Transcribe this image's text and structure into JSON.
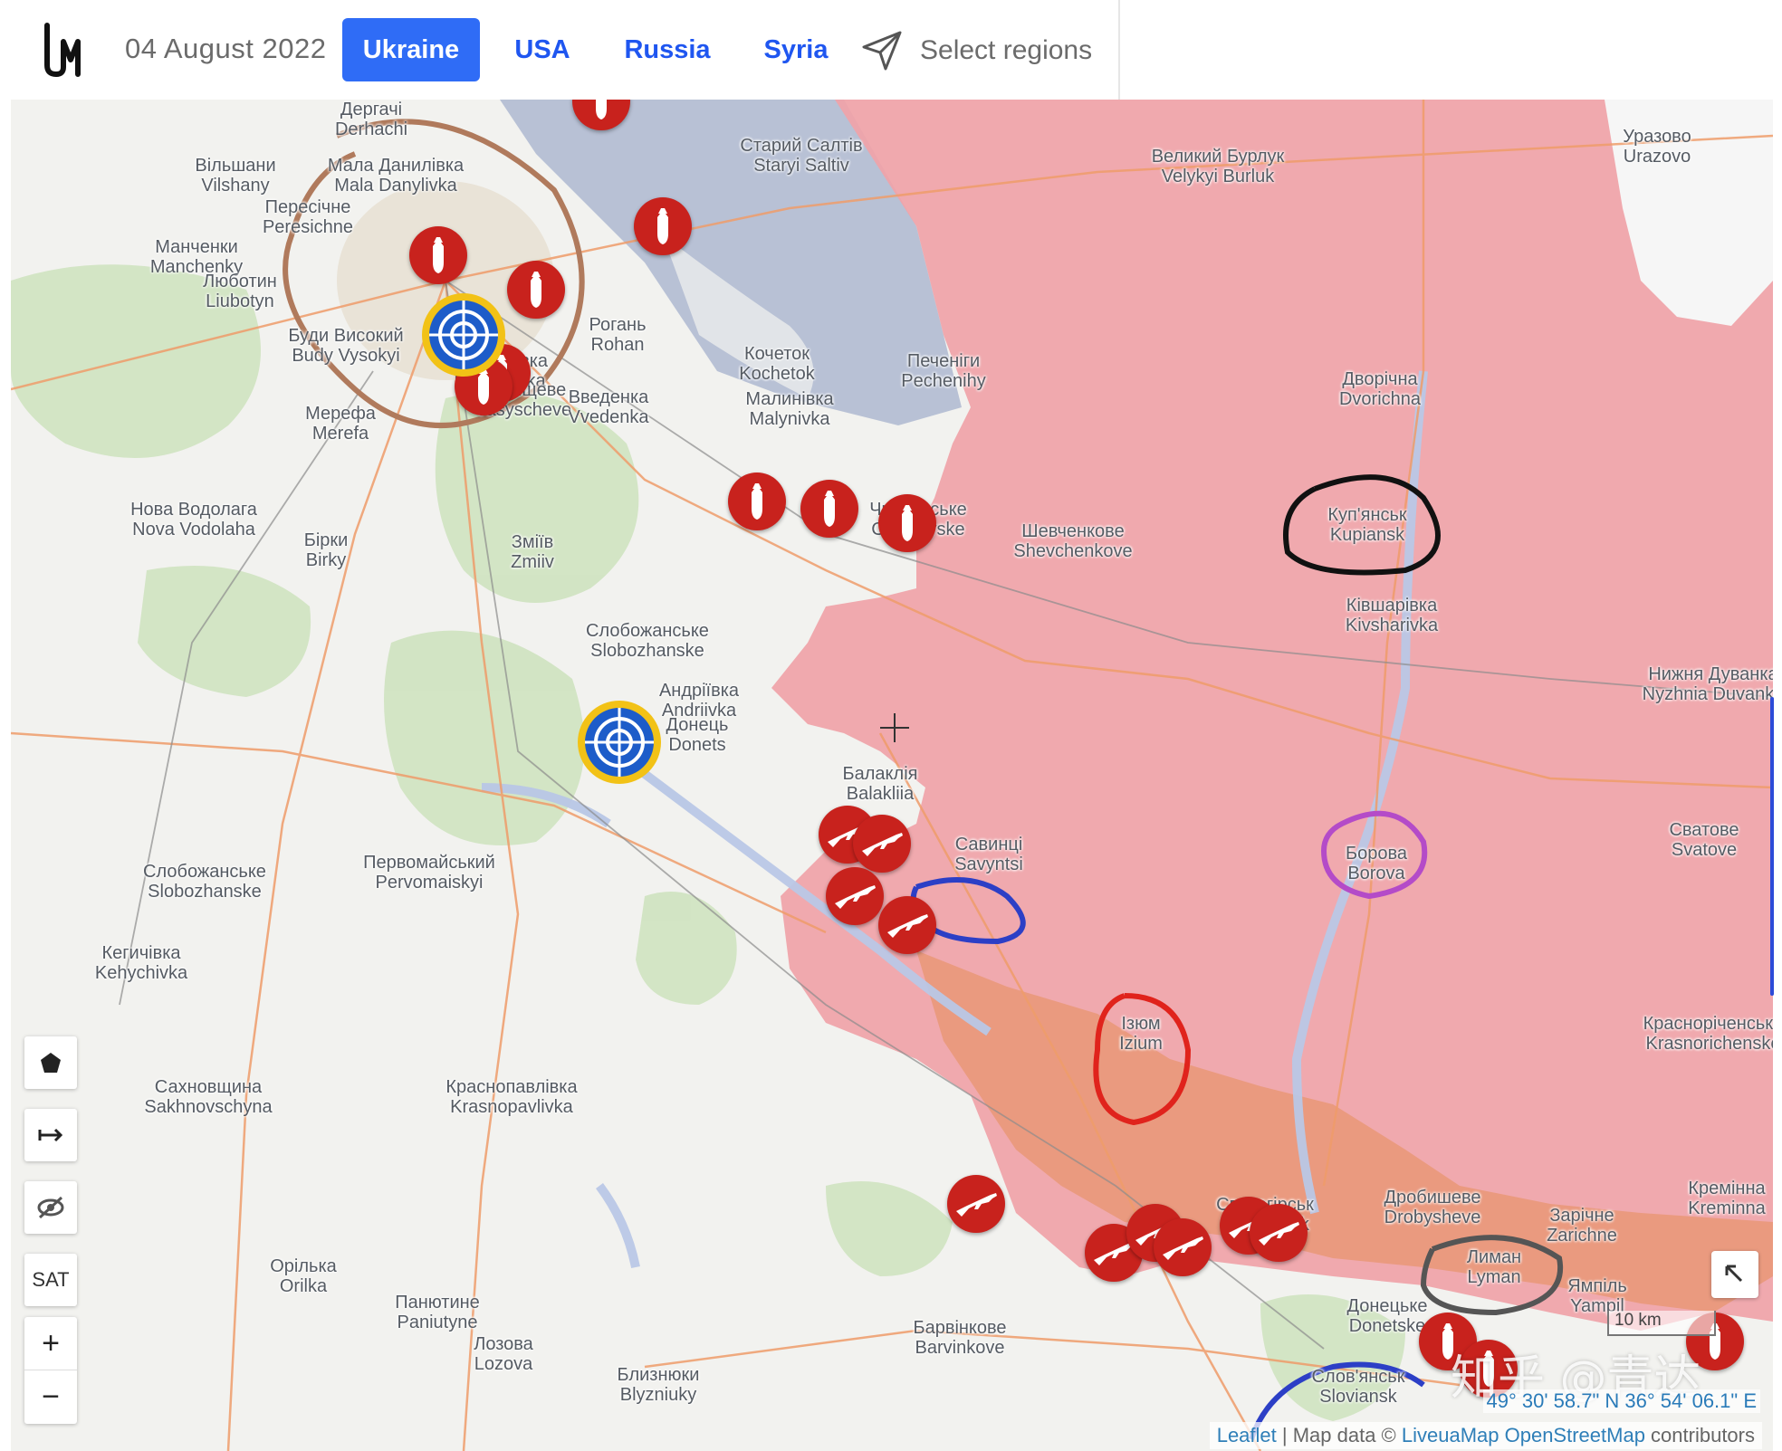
{
  "header": {
    "logo_icon": "liveuamap-logo-icon",
    "date": "04 August 2022",
    "tabs": [
      {
        "label": "Ukraine",
        "active": true
      },
      {
        "label": "USA",
        "active": false
      },
      {
        "label": "Russia",
        "active": false
      },
      {
        "label": "Syria",
        "active": false
      }
    ],
    "select_regions": {
      "icon": "navigation-arrow-icon",
      "label": "Select regions"
    }
  },
  "colors": {
    "accent": "#2f6cf6",
    "occupied_area": "#f0a3a8",
    "contested_area": "#e8956f",
    "river": "#b9c7e6",
    "marker_red": "#c8221d",
    "marker_gold": "#f2c216",
    "marker_blue": "#1d5cc9"
  },
  "map": {
    "places": [
      {
        "uk": "Дергачі",
        "en": "Derhachi"
      },
      {
        "uk": "Вільшани",
        "en": "Vilshany"
      },
      {
        "uk": "Пересічне",
        "en": "Peresichne"
      },
      {
        "uk": "Манченки",
        "en": "Manchenky"
      },
      {
        "uk": "Люботин",
        "en": "Liubotyn"
      },
      {
        "uk": "Мала Данилівка",
        "en": "Mala Danylivka"
      },
      {
        "uk": "Буди Високий",
        "en": "Budy Vysokyi"
      },
      {
        "uk": "Безлюдівка",
        "en": "Bezliudivka"
      },
      {
        "uk": "Васищеве",
        "en": "Vasyscheve"
      },
      {
        "uk": "Мерефа",
        "en": "Merefa"
      },
      {
        "uk": "Рогань",
        "en": "Rohan"
      },
      {
        "uk": "Введенка",
        "en": "Vvedenka"
      },
      {
        "uk": "Кочеток",
        "en": "Kochetok"
      },
      {
        "uk": "Малинівка",
        "en": "Malynivka"
      },
      {
        "uk": "Печеніги",
        "en": "Pechenihy"
      },
      {
        "uk": "Старий Салтів",
        "en": "Staryi Saltiv"
      },
      {
        "uk": "Великий Бурлук",
        "en": "Velykyi Burluk"
      },
      {
        "uk": "Уразово",
        "en": "Urazovo"
      },
      {
        "uk": "Дворічна",
        "en": "Dvorichna"
      },
      {
        "uk": "Куп'янськ",
        "en": "Kupiansk"
      },
      {
        "uk": "Ківшарівка",
        "en": "Kivsharivka"
      },
      {
        "uk": "Чкаловське",
        "en": "Chkalovske"
      },
      {
        "uk": "Шевченкове",
        "en": "Shevchenkove"
      },
      {
        "uk": "Нова Водолага",
        "en": "Nova Vodolaha"
      },
      {
        "uk": "Зміїв",
        "en": "Zmiiv"
      },
      {
        "uk": "Бірки",
        "en": "Birky"
      },
      {
        "uk": "Слобожанське",
        "en": "Slobozhanske"
      },
      {
        "uk": "Андріївка",
        "en": "Andriivka"
      },
      {
        "uk": "Донець",
        "en": "Donets"
      },
      {
        "uk": "Балаклія",
        "en": "Balakliia"
      },
      {
        "uk": "Савинці",
        "en": "Savyntsi"
      },
      {
        "uk": "Слобожанське",
        "en": "Slobozhanske"
      },
      {
        "uk": "Первомайський",
        "en": "Pervomaiskyi"
      },
      {
        "uk": "Кегичівка",
        "en": "Kehychivka"
      },
      {
        "uk": "Борова",
        "en": "Borova"
      },
      {
        "uk": "Сватове",
        "en": "Svatove"
      },
      {
        "uk": "Нижня Дуванка",
        "en": "Nyzhnia Duvanka"
      },
      {
        "uk": "Ізюм",
        "en": "Izium"
      },
      {
        "uk": "Сахновщина",
        "en": "Sakhnovschyna"
      },
      {
        "uk": "Краснопавлівка",
        "en": "Krasnopavlivka"
      },
      {
        "uk": "Красноріченське",
        "en": "Krasnorichenske"
      },
      {
        "uk": "Святогірськ",
        "en": "Sviatohirsk"
      },
      {
        "uk": "Дробишеве",
        "en": "Drobysheve"
      },
      {
        "uk": "Зарічне",
        "en": "Zarichne"
      },
      {
        "uk": "Кремінна",
        "en": "Kreminna"
      },
      {
        "uk": "Лиман",
        "en": "Lyman"
      },
      {
        "uk": "Ямпіль",
        "en": "Yampil"
      },
      {
        "uk": "Донецьке",
        "en": "Donetske"
      },
      {
        "uk": "Орілька",
        "en": "Orilka"
      },
      {
        "uk": "Панютине",
        "en": "Paniutyne"
      },
      {
        "uk": "Лозова",
        "en": "Lozova"
      },
      {
        "uk": "Барвінкове",
        "en": "Barvinkove"
      },
      {
        "uk": "Близнюки",
        "en": "Blyzniuky"
      },
      {
        "uk": "Слов'янськ",
        "en": "Sloviansk"
      }
    ],
    "markers": {
      "bomb_icon": "aerial-bomb-icon",
      "rifle_icon": "assault-rifle-icon",
      "target_icon": "ukraine-military-roundel-icon"
    },
    "controls": {
      "draw_icon": "pentagon-draw-icon",
      "measure_icon": "arrow-right-to-bar-icon",
      "hide_icon": "eye-slash-icon",
      "satellite_label": "SAT",
      "zoom_in": "+",
      "zoom_out": "−",
      "fullscreen_icon": "collapse-arrow-icon"
    },
    "scale_label": "10 km",
    "coordinates": "49° 30' 58.7\" N 36° 54' 06.1\" E",
    "attribution": {
      "leaflet": "Leaflet",
      "sep": " | Map data © ",
      "link": "LiveuaMap OpenStreetMap",
      "suffix": " contributors"
    },
    "watermark": "知乎 @青达"
  }
}
